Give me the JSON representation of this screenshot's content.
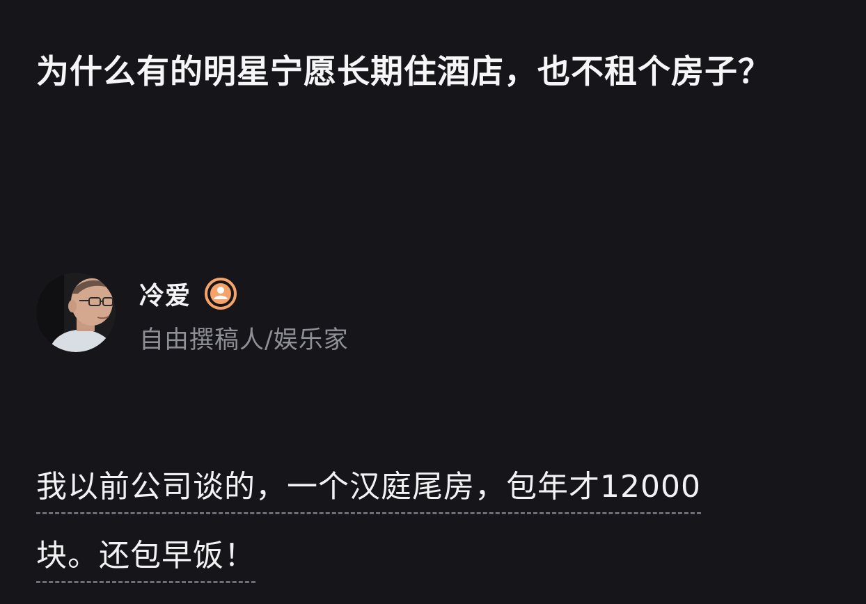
{
  "question": {
    "title": "为什么有的明星宁愿长期住酒店，也不租个房子？"
  },
  "author": {
    "name": "冷爱",
    "bio": "自由撰稿人/娱乐家",
    "avatar_icon": "avatar-photo",
    "badge_icon": "verified-user-badge-icon",
    "badge_color": "#f5a36a"
  },
  "answer": {
    "lines": [
      "我以前公司谈的，一个汉庭尾房，包年才12000",
      "块。还包早饭！"
    ]
  },
  "colors": {
    "background": "#16161a",
    "text": "#f4f4f6",
    "muted": "#8f8f96",
    "underline": "#6e6e76"
  }
}
